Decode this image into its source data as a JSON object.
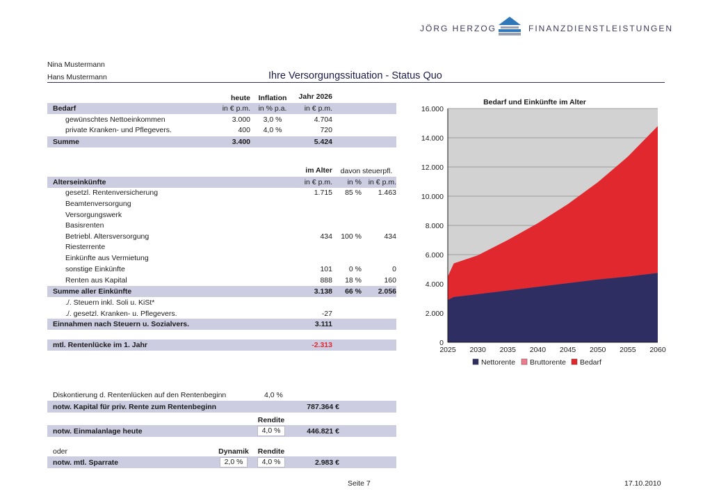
{
  "header": {
    "company_left": "JÖRG HERZOG",
    "company_right": "FINANZDIENSTLEISTUNGEN"
  },
  "names": [
    "Nina Mustermann",
    "Hans Mustermann"
  ],
  "page_title": "Ihre Versorgungssituation - Status Quo",
  "bedarf": {
    "col_heads": [
      "heute",
      "Inflation",
      "Jahr 2026"
    ],
    "section_label": "Bedarf",
    "units": [
      "in € p.m.",
      "in % p.a.",
      "in € p.m."
    ],
    "rows": [
      {
        "label": "gewünschtes Nettoeinkommen",
        "heute": "3.000",
        "inflation": "3,0 %",
        "jahr": "4.704"
      },
      {
        "label": "private Kranken- und Pflegevers.",
        "heute": "400",
        "inflation": "4,0 %",
        "jahr": "720"
      }
    ],
    "sum_label": "Summe",
    "sum_heute": "3.400",
    "sum_jahr": "5.424"
  },
  "einkuenfte": {
    "col_head_alter": "im Alter",
    "col_head_steuer": "davon steuerpfl.",
    "section_label": "Alterseinkünfte",
    "units": [
      "in € p.m.",
      "in %",
      "in € p.m."
    ],
    "rows": [
      {
        "label": "gesetzl. Rentenversicherung",
        "alter": "1.715",
        "pct": "85 %",
        "steuer": "1.463"
      },
      {
        "label": "Beamtenversorgung",
        "alter": "",
        "pct": "",
        "steuer": ""
      },
      {
        "label": "Versorgungswerk",
        "alter": "",
        "pct": "",
        "steuer": ""
      },
      {
        "label": "Basisrenten",
        "alter": "",
        "pct": "",
        "steuer": ""
      },
      {
        "label": "Betriebl. Altersversorgung",
        "alter": "434",
        "pct": "100 %",
        "steuer": "434"
      },
      {
        "label": "Riesterrente",
        "alter": "",
        "pct": "",
        "steuer": ""
      },
      {
        "label": "Einkünfte aus Vermietung",
        "alter": "",
        "pct": "",
        "steuer": ""
      },
      {
        "label": "sonstige Einkünfte",
        "alter": "101",
        "pct": "0 %",
        "steuer": "0"
      },
      {
        "label": "Renten aus Kapital",
        "alter": "888",
        "pct": "18 %",
        "steuer": "160"
      }
    ],
    "sum_label": "Summe aller Einkünfte",
    "sum_alter": "3.138",
    "sum_pct": "66 %",
    "sum_steuer": "2.056",
    "deductions": [
      {
        "label": "./. Steuern inkl. Soli u. KiSt*",
        "value": ""
      },
      {
        "label": "./. gesetzl. Kranken- u. Pflegevers.",
        "value": "-27"
      }
    ],
    "net_label": "Einnahmen nach Steuern u. Sozialvers.",
    "net_value": "3.111",
    "gap_label": "mtl. Rentenlücke im 1. Jahr",
    "gap_value": "-2.313"
  },
  "kapital": {
    "diskont_label": "Diskontierung d. Rentenlücken auf den Rentenbeginn",
    "diskont_value": "4,0 %",
    "kapital_label": "notw. Kapital für priv. Rente zum Rentenbeginn",
    "kapital_value": "787.364 €",
    "rendite_head": "Rendite",
    "einmal_label": "notw. Einmalanlage heute",
    "einmal_rendite": "4,0 %",
    "einmal_value": "446.821 €",
    "oder_label": "oder",
    "dynamik_head": "Dynamik",
    "rendite_head2": "Rendite",
    "spar_label": "notw. mtl. Sparrate",
    "spar_dynamik": "2,0 %",
    "spar_rendite": "4,0 %",
    "spar_value": "2.983 €"
  },
  "footer": {
    "page": "Seite 7",
    "date": "17.10.2010"
  },
  "chart_data": {
    "type": "area",
    "title": "Bedarf und Einkünfte im Alter",
    "x_ticks": [
      "2025",
      "2030",
      "2035",
      "2040",
      "2045",
      "2050",
      "2055",
      "2060"
    ],
    "y_ticks": [
      "0",
      "2.000",
      "4.000",
      "6.000",
      "8.000",
      "10.000",
      "12.000",
      "14.000",
      "16.000"
    ],
    "xlim": [
      2025,
      2060
    ],
    "ylim": [
      0,
      16000
    ],
    "x": [
      2025,
      2026,
      2030,
      2035,
      2040,
      2045,
      2050,
      2055,
      2060
    ],
    "series": [
      {
        "name": "Nettorente",
        "color": "#2e2e62",
        "values": [
          2900,
          3100,
          3300,
          3550,
          3800,
          4050,
          4300,
          4500,
          4750
        ]
      },
      {
        "name": "Bruttorente",
        "color": "#f07c8c",
        "values": [
          2900,
          3100,
          3300,
          3550,
          3800,
          4050,
          4300,
          4500,
          4750
        ]
      },
      {
        "name": "Bedarf",
        "color": "#e0282e",
        "values": [
          4500,
          5400,
          5950,
          7000,
          8150,
          9450,
          10950,
          12700,
          14800
        ]
      }
    ],
    "background": "#d2d2d2",
    "grid": true,
    "legend": "bottom"
  }
}
